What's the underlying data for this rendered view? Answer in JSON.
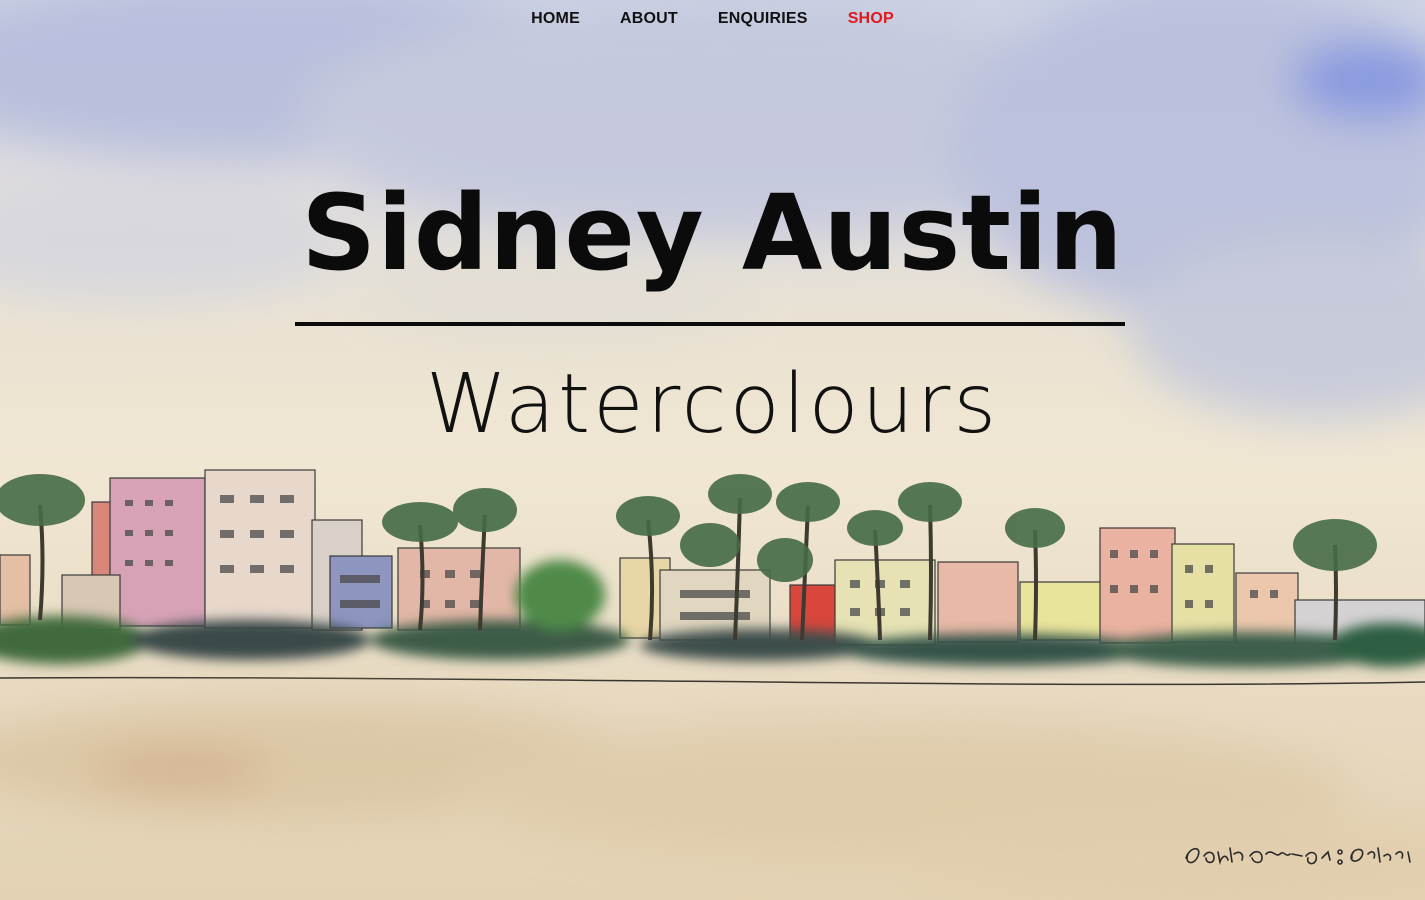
{
  "nav": {
    "items": [
      {
        "label": "HOME",
        "active": false
      },
      {
        "label": "ABOUT",
        "active": false
      },
      {
        "label": "ENQUIRIES",
        "active": false
      },
      {
        "label": "SHOP",
        "active": true
      }
    ],
    "active_color": "#e0191b"
  },
  "hero": {
    "title": "Sidney Austin",
    "subtitle": "Watercolours"
  },
  "artwork": {
    "signature": "South Beach: Sidney"
  }
}
